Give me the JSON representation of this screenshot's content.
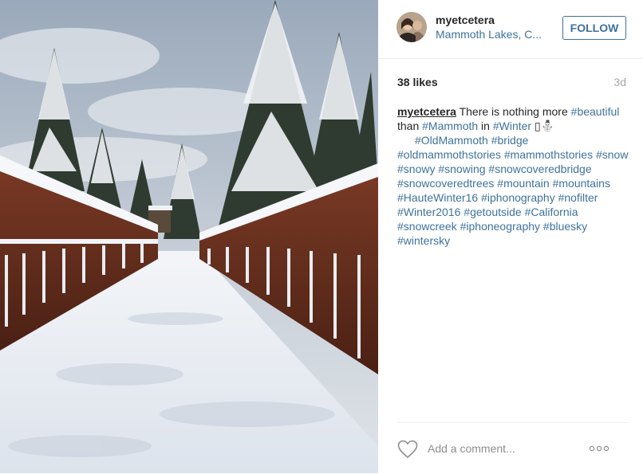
{
  "post": {
    "username": "myetcetera",
    "location": "Mammoth Lakes, C...",
    "follow_label": "FOLLOW",
    "likes": "38 likes",
    "time_ago": "3d",
    "caption": {
      "username": "myetcetera",
      "text_1": " There is nothing more ",
      "tag_1": "#beautiful",
      "text_2": " than ",
      "tag_2": "#Mammoth",
      "text_3": " in ",
      "tag_3": "#Winter",
      "emoji": " ▯⛄",
      "tags_rest": [
        "#OldMammoth",
        "#bridge",
        "#oldmammothstories",
        "#mammothstories",
        "#snow",
        "#snowy",
        "#snowing",
        "#snowcoveredbridge",
        "#snowcoveredtrees",
        "#mountain",
        "#mountains",
        "#HauteWinter16",
        "#iphonography",
        "#nofilter",
        "#Winter2016",
        "#getoutside",
        "#California",
        "#snowcreek",
        "#iphoneography",
        "#bluesky",
        "#wintersky"
      ]
    },
    "comment_placeholder": "Add a comment...",
    "icons": {
      "like": "heart-outline-icon",
      "more": "ellipsis-icon"
    },
    "colors": {
      "link": "#3f729b",
      "text": "#262626",
      "muted": "#a5a7aa"
    }
  }
}
